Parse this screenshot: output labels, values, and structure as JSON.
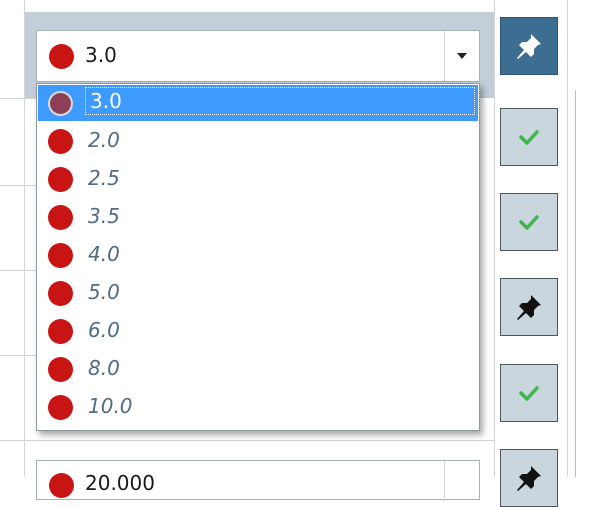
{
  "combo_top": {
    "selected_value": "3.0",
    "dot_color": "#c91414",
    "dropdown_arrow_icon": "chevron-down-icon"
  },
  "dropdown": {
    "options": [
      "3.0",
      "2.0",
      "2.5",
      "3.5",
      "4.0",
      "5.0",
      "6.0",
      "8.0",
      "10.0"
    ],
    "highlighted_index": 0,
    "highlight_color": "#3d9bff"
  },
  "combo_bottom": {
    "selected_value": "20.000"
  },
  "actions": [
    {
      "icon": "pin-icon",
      "active": true
    },
    {
      "icon": "check-icon",
      "active": false
    },
    {
      "icon": "check-icon",
      "active": false
    },
    {
      "icon": "pin-icon",
      "active": false
    },
    {
      "icon": "check-icon",
      "active": false
    },
    {
      "icon": "pin-icon",
      "active": false
    }
  ],
  "colors": {
    "check": "#3fb34f",
    "pin_active_bg": "#3e6d92",
    "button_bg": "#c9d6de"
  }
}
